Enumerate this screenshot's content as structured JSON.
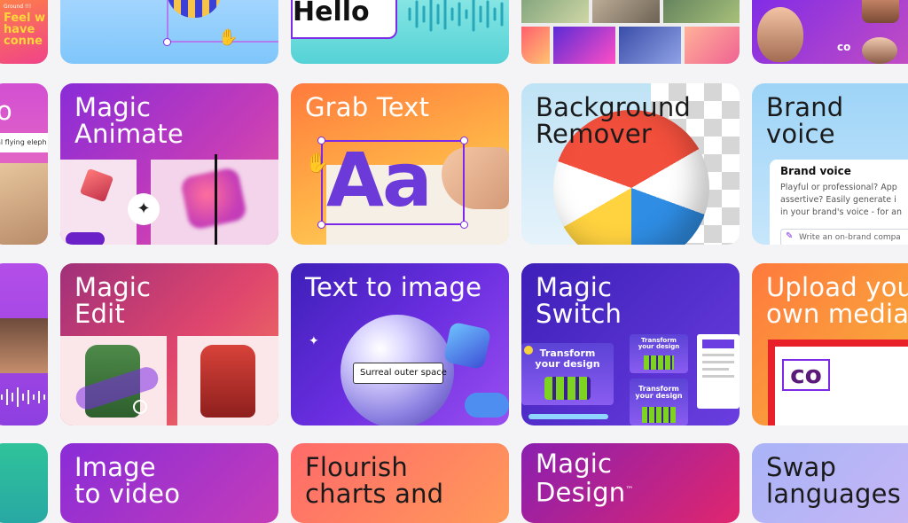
{
  "row1": {
    "ad_text": [
      "Feel w",
      "have",
      "conne"
    ],
    "ad_tag": "Ground !!!",
    "hello": "Hello"
  },
  "row2": {
    "partial_prompt_fragment": "o",
    "partial_prompt": "al flying eleph",
    "magic_animate": [
      "Magic",
      "Animate"
    ],
    "grab_text": "Grab Text",
    "grab_text_sample": "Aa",
    "background_remover": [
      "Background",
      "Remover"
    ],
    "brand_voice": [
      "Brand",
      "voice"
    ],
    "brand_voice_panel": {
      "title": "Brand voice",
      "body": [
        "Playful or professional? App",
        "assertive? Easily generate i",
        "in your brand's voice - for an"
      ],
      "input_placeholder": "Write an on-brand compa"
    }
  },
  "row3": {
    "magic_edit": [
      "Magic",
      "Edit"
    ],
    "text_to_image": "Text to image",
    "text_to_image_prompt": "Surreal outer space",
    "magic_switch": [
      "Magic",
      "Switch"
    ],
    "transform_text": [
      "Transform",
      "your design"
    ],
    "upload_media": [
      "Upload you",
      "own media"
    ]
  },
  "row4": {
    "image_to_video": [
      "Image",
      "to video"
    ],
    "flourish": [
      "Flourish",
      "charts and"
    ],
    "magic_design": [
      "Magic",
      "Design"
    ],
    "trademark": "™",
    "swap_languages": [
      "Swap",
      "languages"
    ]
  },
  "colors": {
    "brand_purple": "#7d2ae8",
    "background": "#f4f3f6"
  }
}
